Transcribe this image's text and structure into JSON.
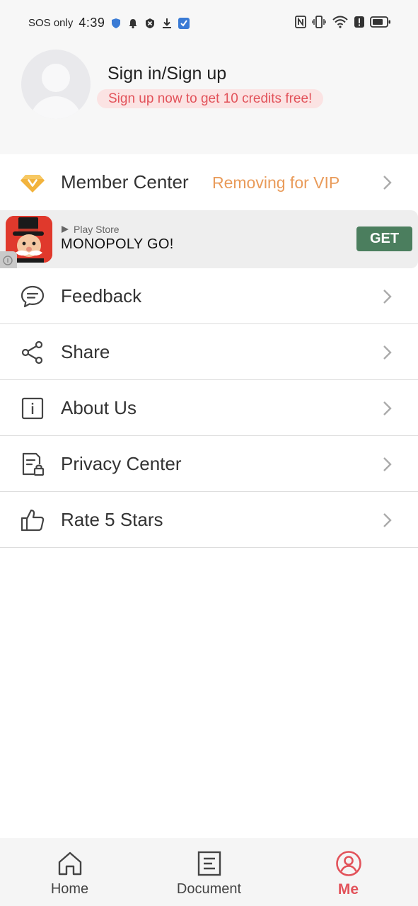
{
  "status_bar": {
    "carrier": "SOS only",
    "time": "4:39"
  },
  "profile": {
    "title": "Sign in/Sign up",
    "promo": "Sign up now to get 10 credits free!"
  },
  "member_center": {
    "label": "Member Center",
    "vip_text": "Removing for VIP",
    "icon": "diamond-v-icon"
  },
  "ad": {
    "store": "Play Store",
    "title": "MONOPOLY GO!",
    "button": "GET"
  },
  "menu": [
    {
      "label": "Feedback",
      "icon": "chat-bubble-icon"
    },
    {
      "label": "Share",
      "icon": "share-icon"
    },
    {
      "label": "About Us",
      "icon": "info-icon"
    },
    {
      "label": "Privacy Center",
      "icon": "document-lock-icon"
    },
    {
      "label": "Rate 5 Stars",
      "icon": "thumbs-up-icon"
    }
  ],
  "bottom_nav": [
    {
      "label": "Home",
      "icon": "home-icon",
      "active": false
    },
    {
      "label": "Document",
      "icon": "document-icon",
      "active": false
    },
    {
      "label": "Me",
      "icon": "user-circle-icon",
      "active": true
    }
  ],
  "colors": {
    "accent": "#e2525a",
    "vip": "#e99b5a",
    "ad_button": "#4b7e5e"
  }
}
